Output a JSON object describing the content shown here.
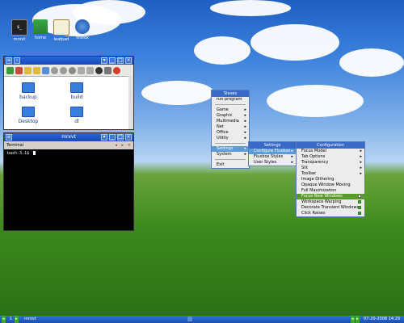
{
  "desktop_icons": [
    {
      "label": "mrxvt",
      "icon": "terminal-icon"
    },
    {
      "label": "home",
      "icon": "home-icon"
    },
    {
      "label": "leafpad",
      "icon": "leafpad-icon"
    },
    {
      "label": "firefox",
      "icon": "firefox-icon"
    }
  ],
  "file_manager": {
    "folders": [
      "backup",
      "build",
      "Desktop",
      "dl"
    ]
  },
  "terminal": {
    "title": "mrxvt",
    "tab": "Terminal",
    "prompt": "bash-3.1$"
  },
  "root_menu": {
    "title": "Slaxes",
    "items": [
      "run program",
      "Game",
      "Graphic",
      "Multimedia",
      "Net",
      "Office",
      "Utility",
      "Settings",
      "System",
      "Exit"
    ]
  },
  "settings_menu": {
    "title": "Settings",
    "items": [
      "Configure Fluxbox",
      "Fluxbox Styles",
      "User Styles"
    ]
  },
  "config_menu": {
    "title": "Configuration",
    "items": [
      "Focus Model",
      "Tab Options",
      "Transparency",
      "Slit",
      "Toolbar",
      "Image Dithering",
      "Opaque Window Moving",
      "Full Maximization",
      "Focus New Windows",
      "Workspace Warping",
      "Decorate Transient Windows",
      "Click Raises"
    ]
  },
  "taskbar": {
    "workspace": "1",
    "task": "mrxvt",
    "datetime": "07-20-2008 14:29"
  },
  "colors": {
    "title_blue": "#1848b8",
    "menu_select": "#5c9ad8",
    "toggle_on": "#4aa83a"
  }
}
